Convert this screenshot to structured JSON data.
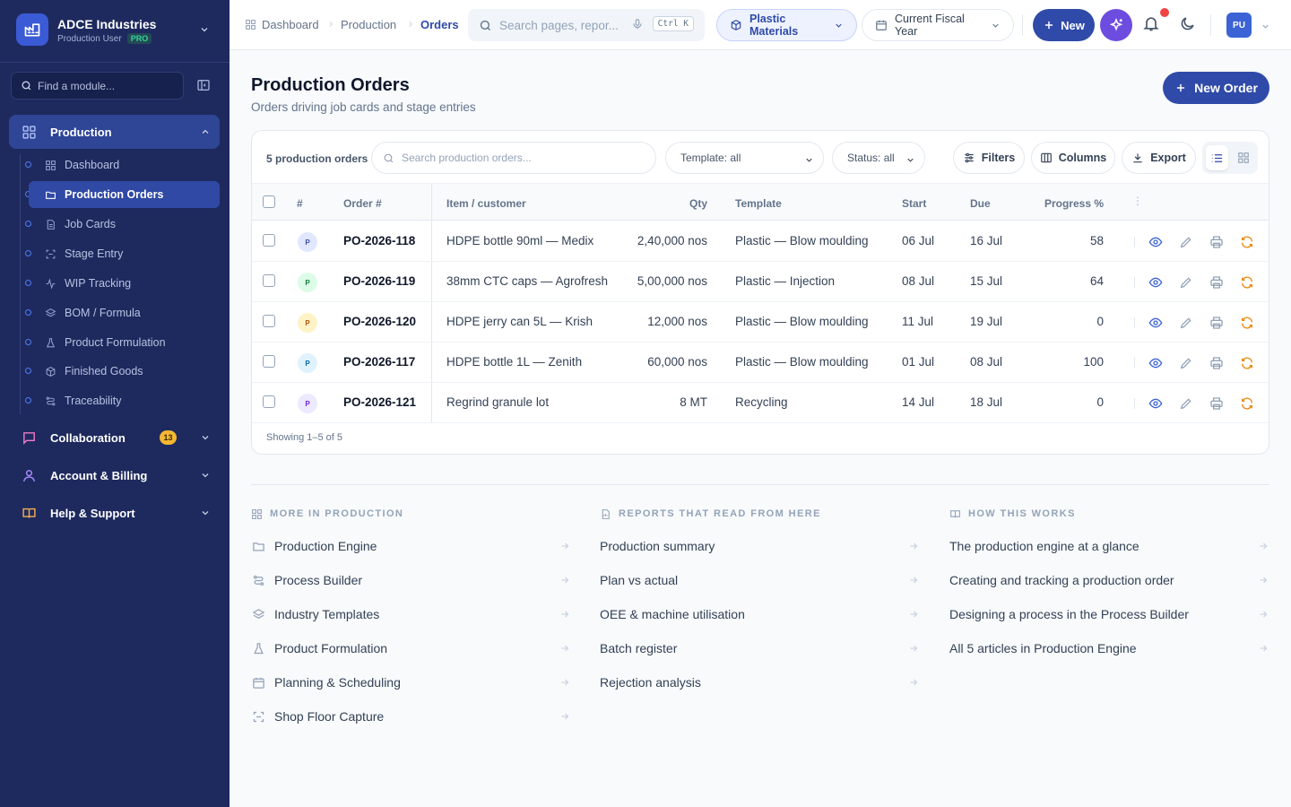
{
  "org": {
    "name": "ADCE Industries",
    "user": "Production User",
    "plan": "PRO"
  },
  "sidebar": {
    "find_placeholder": "Find a module...",
    "groups": [
      {
        "label": "Production",
        "icon": "grid-icon"
      },
      {
        "label": "Collaboration",
        "icon": "chat-icon",
        "badge": "13"
      },
      {
        "label": "Account & Billing",
        "icon": "user-icon"
      },
      {
        "label": "Help & Support",
        "icon": "book-icon"
      }
    ],
    "items": [
      {
        "label": "Dashboard",
        "icon": "grid-icon"
      },
      {
        "label": "Production Orders",
        "icon": "folder-icon"
      },
      {
        "label": "Job Cards",
        "icon": "file-icon"
      },
      {
        "label": "Stage Entry",
        "icon": "scan-icon"
      },
      {
        "label": "WIP Tracking",
        "icon": "activity-icon"
      },
      {
        "label": "BOM / Formula",
        "icon": "layers-icon"
      },
      {
        "label": "Product Formulation",
        "icon": "flask-icon"
      },
      {
        "label": "Finished Goods",
        "icon": "box-icon"
      },
      {
        "label": "Traceability",
        "icon": "route-icon"
      }
    ]
  },
  "topbar": {
    "breadcrumb": [
      "Dashboard",
      "Production",
      "Orders"
    ],
    "search_placeholder": "Search pages, repor...",
    "search_kbd": "Ctrl K",
    "material": "Plastic Materials",
    "period": "Current Fiscal Year",
    "new_label": "New",
    "avatar_initials": "PU"
  },
  "page": {
    "title": "Production Orders",
    "subtitle": "Orders driving job cards and stage entries",
    "new_order_label": "New Order"
  },
  "table": {
    "count_label": "5 production orders",
    "search_placeholder": "Search production orders...",
    "template_filter": "Template: all",
    "status_filter": "Status: all",
    "filters_label": "Filters",
    "columns_label": "Columns",
    "export_label": "Export",
    "headers": [
      "#",
      "Order #",
      "Item / customer",
      "Qty",
      "Template",
      "Start",
      "Due",
      "Progress %"
    ],
    "rows": [
      {
        "chip": "P",
        "order": "PO-2026-118",
        "item": "HDPE bottle 90ml — Medix",
        "qty": "2,40,000 nos",
        "template": "Plastic — Blow moulding",
        "start": "06 Jul",
        "due": "16 Jul",
        "progress": "58"
      },
      {
        "chip": "P",
        "order": "PO-2026-119",
        "item": "38mm CTC caps — Agrofresh",
        "qty": "5,00,000 nos",
        "template": "Plastic — Injection",
        "start": "08 Jul",
        "due": "15 Jul",
        "progress": "64"
      },
      {
        "chip": "P",
        "order": "PO-2026-120",
        "item": "HDPE jerry can 5L — Krish",
        "qty": "12,000 nos",
        "template": "Plastic — Blow moulding",
        "start": "11 Jul",
        "due": "19 Jul",
        "progress": "0"
      },
      {
        "chip": "P",
        "order": "PO-2026-117",
        "item": "HDPE bottle 1L — Zenith",
        "qty": "60,000 nos",
        "template": "Plastic — Blow moulding",
        "start": "01 Jul",
        "due": "08 Jul",
        "progress": "100"
      },
      {
        "chip": "P",
        "order": "PO-2026-121",
        "item": "Regrind granule lot",
        "qty": "8 MT",
        "template": "Recycling",
        "start": "14 Jul",
        "due": "18 Jul",
        "progress": "0"
      }
    ],
    "footer": "Showing 1–5 of 5"
  },
  "links": {
    "more": {
      "heading": "MORE IN PRODUCTION",
      "items": [
        {
          "label": "Production Engine",
          "icon": "folder-icon"
        },
        {
          "label": "Process Builder",
          "icon": "route-icon"
        },
        {
          "label": "Industry Templates",
          "icon": "layers-icon"
        },
        {
          "label": "Product Formulation",
          "icon": "flask-icon"
        },
        {
          "label": "Planning & Scheduling",
          "icon": "calendar-icon"
        },
        {
          "label": "Shop Floor Capture",
          "icon": "scan-icon"
        }
      ]
    },
    "reports": {
      "heading": "REPORTS THAT READ FROM HERE",
      "items": [
        "Production summary",
        "Plan vs actual",
        "OEE & machine utilisation",
        "Batch register",
        "Rejection analysis"
      ]
    },
    "how": {
      "heading": "HOW THIS WORKS",
      "items": [
        "The production engine at a glance",
        "Creating and tracking a production order",
        "Designing a process in the Process Builder",
        "All 5 articles in Production Engine"
      ]
    }
  },
  "colors": {
    "sidebar": "#1e2a5e",
    "accent": "#2f4aa8",
    "ai": "#6d4ce0",
    "badge": "#f5b731",
    "pro": "#34d399"
  }
}
